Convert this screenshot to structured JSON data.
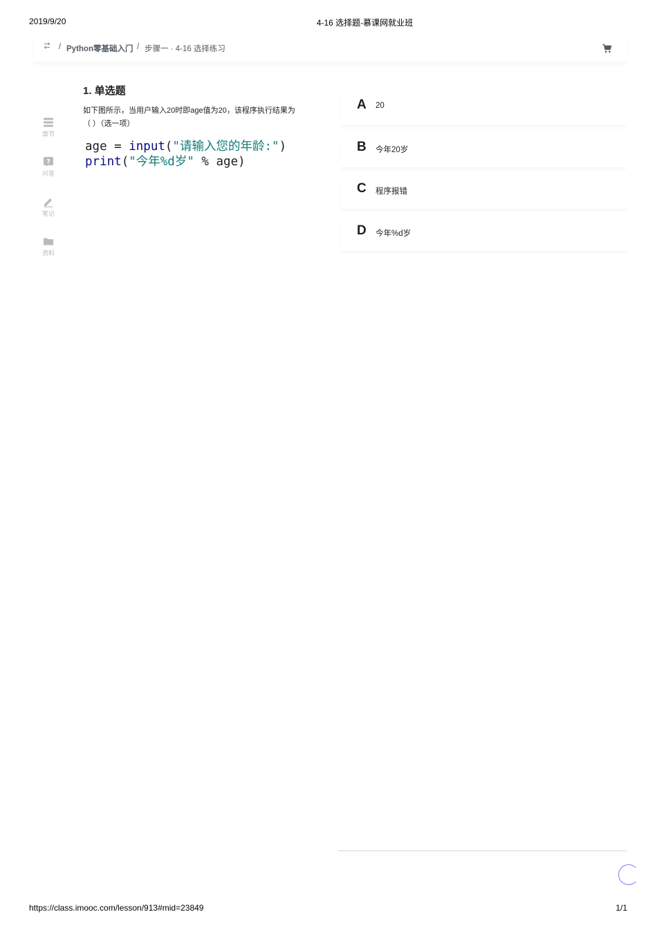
{
  "print_header": {
    "date": "2019/9/20",
    "title": "4-16 选择题-慕课网就业班"
  },
  "print_footer": {
    "url": "https://class.imooc.com/lesson/913#mid=23849",
    "page": "1/1"
  },
  "breadcrumb": {
    "separator": "/",
    "course": "Python零基础入门",
    "lesson": "步骤一 · 4-16 选择练习"
  },
  "icons": {
    "back": "swap-arrows-icon",
    "cart": "shopping-cart-icon"
  },
  "sidebar": {
    "items": [
      {
        "label": "章节",
        "icon": "chapter-list-icon"
      },
      {
        "label": "问答",
        "icon": "question-icon"
      },
      {
        "label": "笔记",
        "icon": "pencil-icon"
      },
      {
        "label": "资料",
        "icon": "folder-icon"
      }
    ]
  },
  "question": {
    "title": "1. 单选题",
    "description": "如下图所示，当用户输入20时即age值为20，该程序执行结果为（ ）（选一项）",
    "code_line1": {
      "a": "age = ",
      "fn": "input",
      "b": "(",
      "str": "\"请输入您的年龄:\"",
      "c": ")"
    },
    "code_line2": {
      "fn": "print",
      "b": "(",
      "str": "\"今年%d岁\"",
      "c": " % age)"
    }
  },
  "options": [
    {
      "letter": "A",
      "text": "20"
    },
    {
      "letter": "B",
      "text": "今年20岁"
    },
    {
      "letter": "C",
      "text": "程序报错"
    },
    {
      "letter": "D",
      "text": "今年%d岁"
    }
  ],
  "colors": {
    "text": "#1c1f21",
    "muted": "#b7bbbf",
    "keyword": "#0b0b82",
    "string": "#117d7b",
    "accent": "#9b6ff2"
  }
}
